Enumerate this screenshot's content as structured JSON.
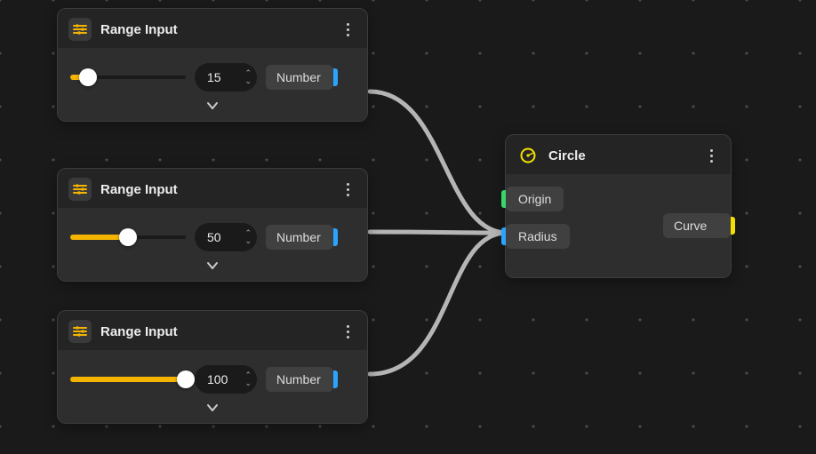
{
  "nodes": {
    "range1": {
      "title": "Range Input",
      "value": "15",
      "percent": 15,
      "output_label": "Number"
    },
    "range2": {
      "title": "Range Input",
      "value": "50",
      "percent": 50,
      "output_label": "Number"
    },
    "range3": {
      "title": "Range Input",
      "value": "100",
      "percent": 100,
      "output_label": "Number"
    },
    "circle": {
      "title": "Circle",
      "inputs": {
        "origin": "Origin",
        "radius": "Radius"
      },
      "outputs": {
        "curve": "Curve"
      }
    }
  },
  "edges": [
    {
      "from": "range1.Number",
      "to": "circle.Radius"
    },
    {
      "from": "range2.Number",
      "to": "circle.Radius"
    },
    {
      "from": "range3.Number",
      "to": "circle.Radius"
    }
  ],
  "colors": {
    "accent": "#f4b400",
    "number_port": "#2aa4ff",
    "point_port": "#38d66b",
    "curve_port": "#f4e000"
  }
}
